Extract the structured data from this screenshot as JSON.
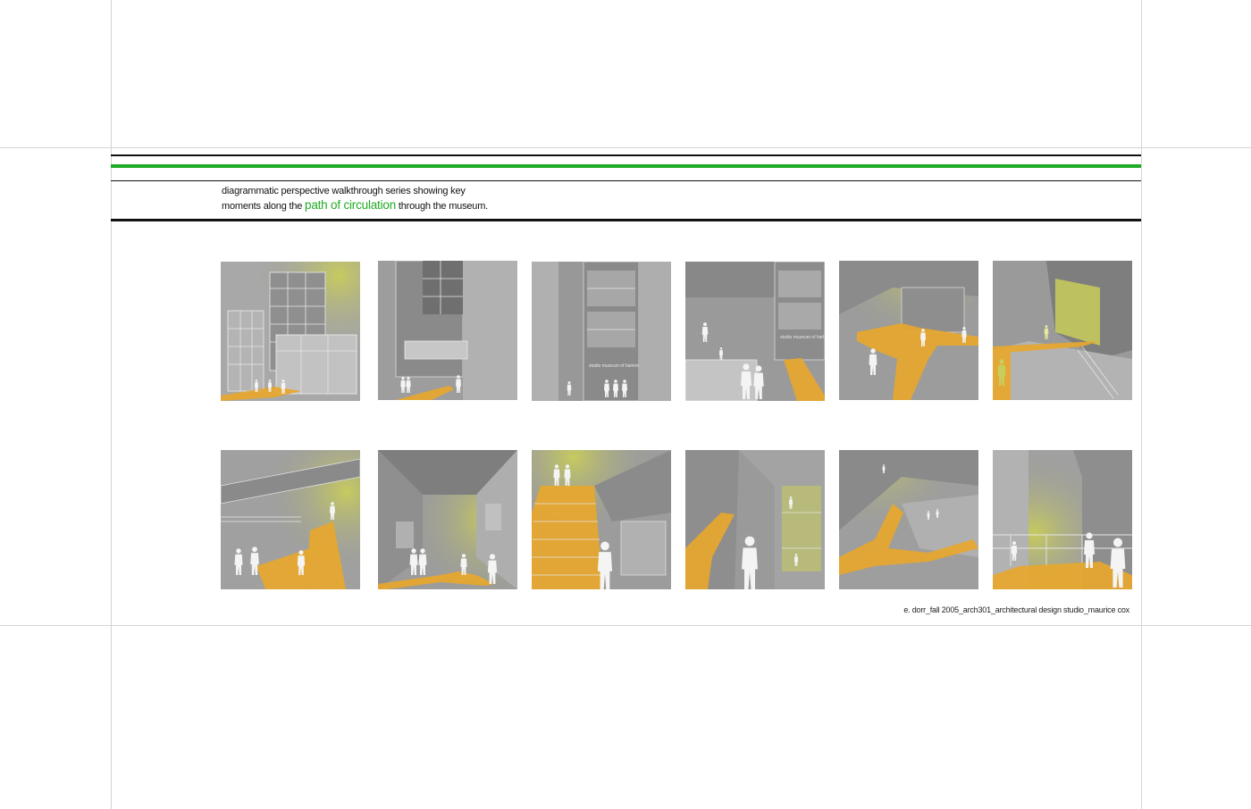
{
  "caption": {
    "line1": "diagrammatic perspective walkthrough series showing key",
    "line2_before": "moments along the",
    "line2_highlight": "path of circulation",
    "line2_after": "through the museum."
  },
  "panels": [
    {
      "sign": ""
    },
    {
      "sign": ""
    },
    {
      "sign": "studio museum of harlem"
    },
    {
      "sign": "studio museum of harlem"
    },
    {
      "sign": ""
    },
    {
      "sign": ""
    },
    {
      "sign": ""
    },
    {
      "sign": ""
    },
    {
      "sign": ""
    },
    {
      "sign": ""
    },
    {
      "sign": ""
    },
    {
      "sign": ""
    }
  ],
  "credit": "e. dorr_fall 2005_arch301_architectural design studio_maurice cox",
  "colors": {
    "accent_green": "#1fab24",
    "path_orange": "#e7a72c",
    "glow_yellow": "#c9cd5a",
    "rule_black": "#111111",
    "guide_gray": "#d4d4d4"
  }
}
